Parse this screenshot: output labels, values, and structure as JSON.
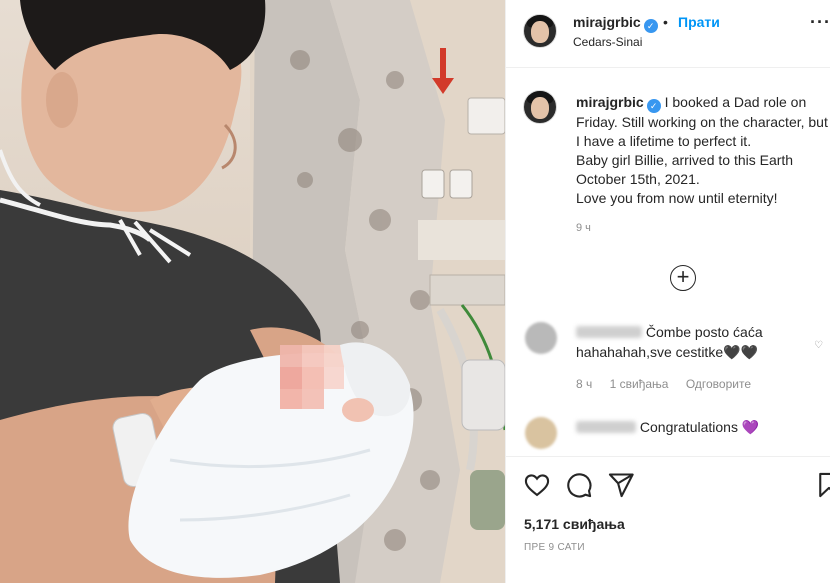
{
  "post": {
    "username": "mirajgrbic",
    "verified_glyph": "✓",
    "dot": "•",
    "follow_label": "Прати",
    "location": "Cedars-Sinai",
    "more_glyph": "···",
    "caption": {
      "text_line1_rest": " I booked a Dad role on",
      "lines": [
        "Friday. Still working on the character, but",
        "I have a lifetime to perfect it.",
        "Baby girl Billie, arrived to this Earth",
        "October 15th, 2021.",
        "Love you from now until eternity!"
      ],
      "time": "9 ч"
    },
    "load_more_glyph": "+",
    "comments": [
      {
        "text_rest": "Čombe posto ćaća",
        "text_line2": "hahahahah,sve cestitke🖤🖤",
        "time": "8 ч",
        "likes": "1 свиђања",
        "reply_label": "Одговорите",
        "like_glyph": "♡"
      },
      {
        "text_rest": "Congratulations",
        "emoji": "💜"
      }
    ],
    "likes_count": "5,171 свиђања",
    "posted_ago": "ПРЕ 9 САТИ"
  },
  "icons": {
    "like": "heart-outline-icon",
    "comment": "comment-bubble-icon",
    "share": "paper-plane-icon",
    "save": "bookmark-icon",
    "add": "plus-circle-icon",
    "more": "ellipsis-icon",
    "verified": "verified-badge-icon"
  },
  "colors": {
    "accent": "#0095f6",
    "verified": "#3897f0",
    "text": "#262626",
    "muted": "#8e8e8e",
    "border": "#efefef"
  }
}
